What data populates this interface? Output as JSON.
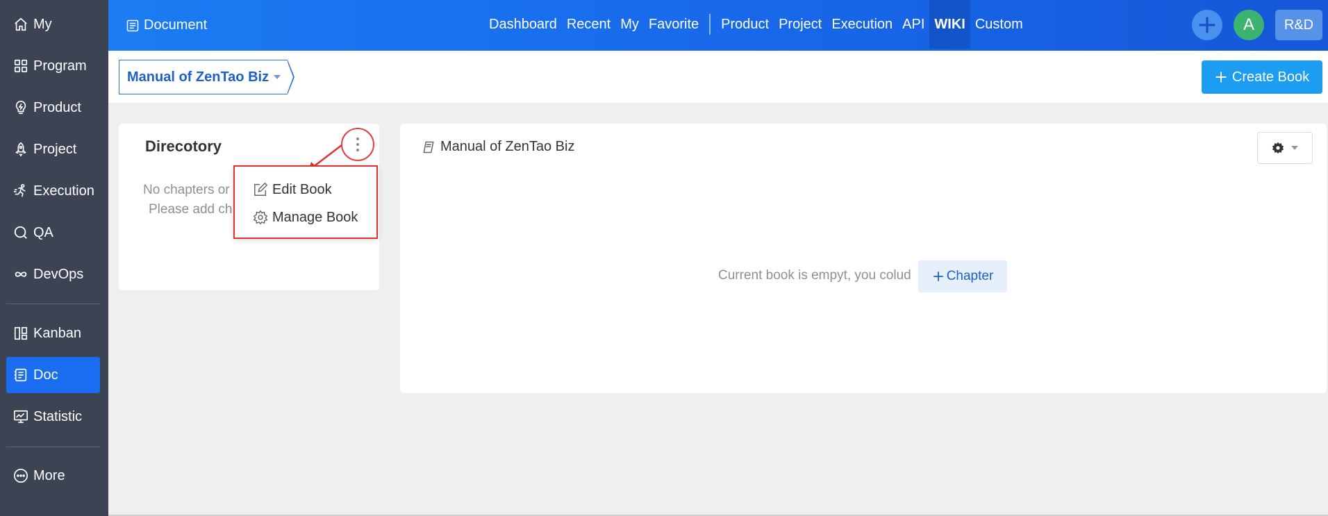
{
  "sidebar": {
    "items": [
      {
        "label": "My",
        "icon": "home-icon"
      },
      {
        "label": "Program",
        "icon": "grid-icon"
      },
      {
        "label": "Product",
        "icon": "bulb-icon"
      },
      {
        "label": "Project",
        "icon": "rocket-icon"
      },
      {
        "label": "Execution",
        "icon": "run-icon"
      },
      {
        "label": "QA",
        "icon": "search-icon"
      },
      {
        "label": "DevOps",
        "icon": "infinity-icon"
      },
      {
        "label": "Kanban",
        "icon": "kanban-icon"
      },
      {
        "label": "Doc",
        "icon": "doc-icon"
      },
      {
        "label": "Statistic",
        "icon": "monitor-icon"
      },
      {
        "label": "More",
        "icon": "more-circle-icon"
      }
    ],
    "active": "Doc"
  },
  "topbar": {
    "title": "Document",
    "nav": [
      "Dashboard",
      "Recent",
      "My",
      "Favorite",
      "Product",
      "Project",
      "Execution",
      "API",
      "WIKI",
      "Custom"
    ],
    "active": "WIKI",
    "avatar_letter": "A",
    "team_label": "R&D"
  },
  "subbar": {
    "book_name": "Manual of ZenTao Biz",
    "create_label": "Create Book"
  },
  "directory": {
    "title": "Direcotory",
    "empty_line1": "No chapters or",
    "empty_line2": "Please add ch",
    "menu": [
      "Edit Book",
      "Manage Book"
    ]
  },
  "content": {
    "title": "Manual of ZenTao Biz",
    "empty_msg": "Current book is empyt, you colud",
    "chapter_label": "Chapter"
  },
  "colors": {
    "sidebar_bg": "#3c4353",
    "topbar": "#1766e8",
    "active": "#1a6cf0",
    "highlight": "#e03030"
  }
}
